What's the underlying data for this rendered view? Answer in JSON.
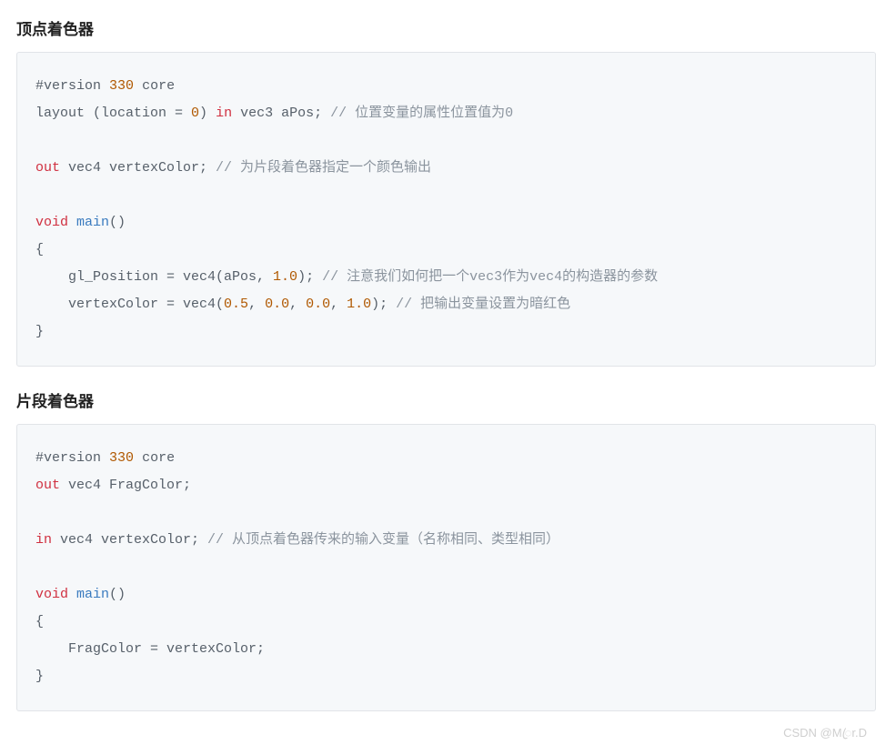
{
  "section1": {
    "title": "顶点着色器",
    "code": {
      "version_directive": "#version",
      "version_num": "330",
      "version_core": "core",
      "l2_a": "layout (location = ",
      "l2_loc": "0",
      "l2_b": ") ",
      "l2_in": "in",
      "l2_c": " vec3 aPos; ",
      "l2_comment": "// 位置变量的属性位置值为0",
      "l4_out": "out",
      "l4_body": " vec4 vertexColor; ",
      "l4_comment": "// 为片段着色器指定一个颜色输出",
      "l6_void": "void",
      "l6_sp": " ",
      "l6_main": "main",
      "l6_parens": "()",
      "l7": "{",
      "l8_indent": "    gl_Position = vec4(aPos, ",
      "l8_n1": "1.0",
      "l8_mid": "); ",
      "l8_comment": "// 注意我们如何把一个vec3作为vec4的构造器的参数",
      "l9_indent": "    vertexColor = vec4(",
      "l9_n1": "0.5",
      "l9_s1": ", ",
      "l9_n2": "0.0",
      "l9_s2": ", ",
      "l9_n3": "0.0",
      "l9_s3": ", ",
      "l9_n4": "1.0",
      "l9_end": "); ",
      "l9_comment": "// 把输出变量设置为暗红色",
      "l10": "}"
    }
  },
  "section2": {
    "title": "片段着色器",
    "code": {
      "version_directive": "#version",
      "version_num": "330",
      "version_core": "core",
      "l2_out": "out",
      "l2_body": " vec4 FragColor;",
      "l4_in": "in",
      "l4_body": " vec4 vertexColor; ",
      "l4_comment": "// 从顶点着色器传来的输入变量（名称相同、类型相同）",
      "l6_void": "void",
      "l6_sp": " ",
      "l6_main": "main",
      "l6_parens": "()",
      "l7": "{",
      "l8": "    FragColor = vertexColor;",
      "l9": "}"
    }
  },
  "watermark": "CSDN @Mꦿr.D"
}
